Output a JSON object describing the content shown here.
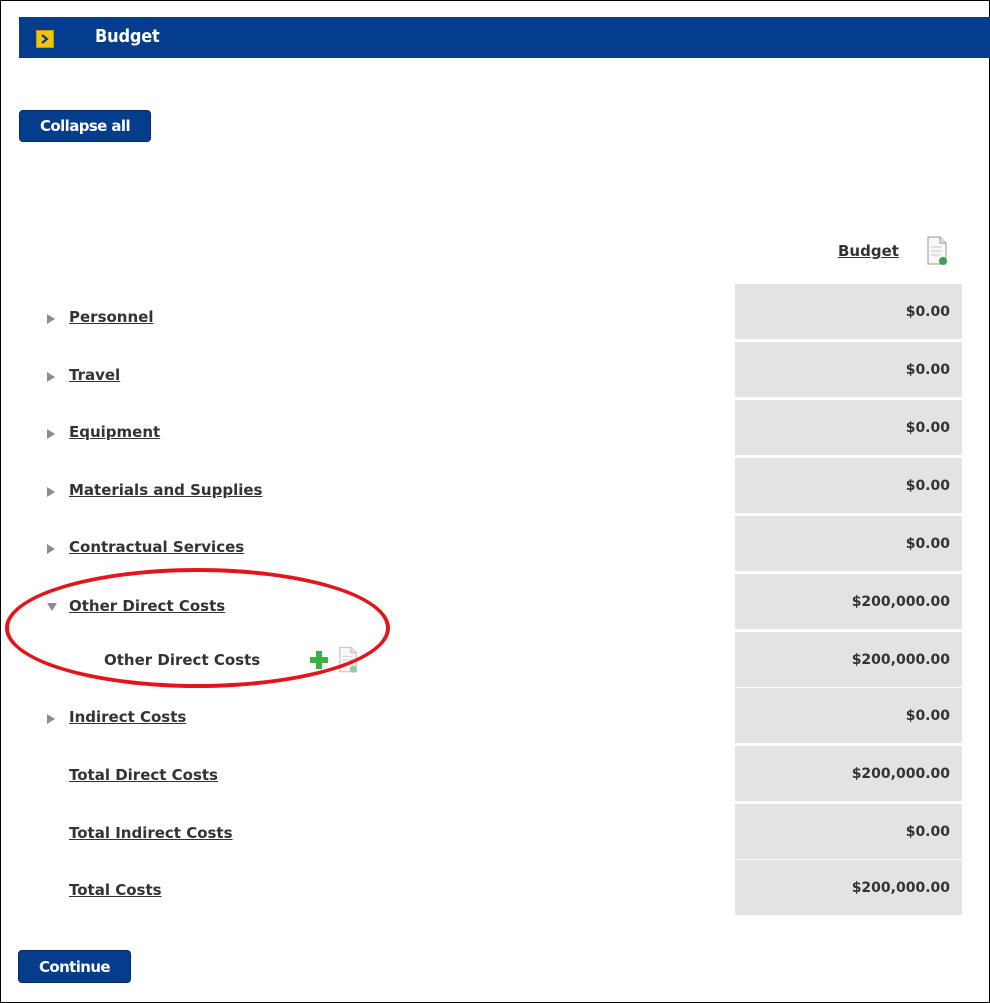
{
  "header": {
    "title": "Budget",
    "icon": "chevron-right-icon"
  },
  "buttons": {
    "collapse_all": "Collapse all",
    "continue": "Continue"
  },
  "column": {
    "header": "Budget",
    "icon": "document-add-icon"
  },
  "rows": [
    {
      "label": "Personnel",
      "value": "$0.00",
      "expand": "collapsed"
    },
    {
      "label": "Travel",
      "value": "$0.00",
      "expand": "collapsed"
    },
    {
      "label": "Equipment",
      "value": "$0.00",
      "expand": "collapsed"
    },
    {
      "label": "Materials and Supplies",
      "value": "$0.00",
      "expand": "collapsed"
    },
    {
      "label": "Contractual Services",
      "value": "$0.00",
      "expand": "collapsed"
    },
    {
      "label": "Other Direct Costs",
      "value": "$200,000.00",
      "expand": "expanded"
    },
    {
      "label": "Other Direct Costs",
      "value": "$200,000.00",
      "expand": "child"
    },
    {
      "label": "Indirect Costs",
      "value": "$0.00",
      "expand": "collapsed"
    },
    {
      "label": "Total Direct Costs",
      "value": "$200,000.00",
      "expand": "none"
    },
    {
      "label": "Total Indirect Costs",
      "value": "$0.00",
      "expand": "none"
    },
    {
      "label": "Total Costs",
      "value": "$200,000.00",
      "expand": "none"
    }
  ],
  "colors": {
    "header_bg": "#053d8d",
    "highlight": "#e3151b",
    "cell_bg": "#e3e3e3"
  }
}
